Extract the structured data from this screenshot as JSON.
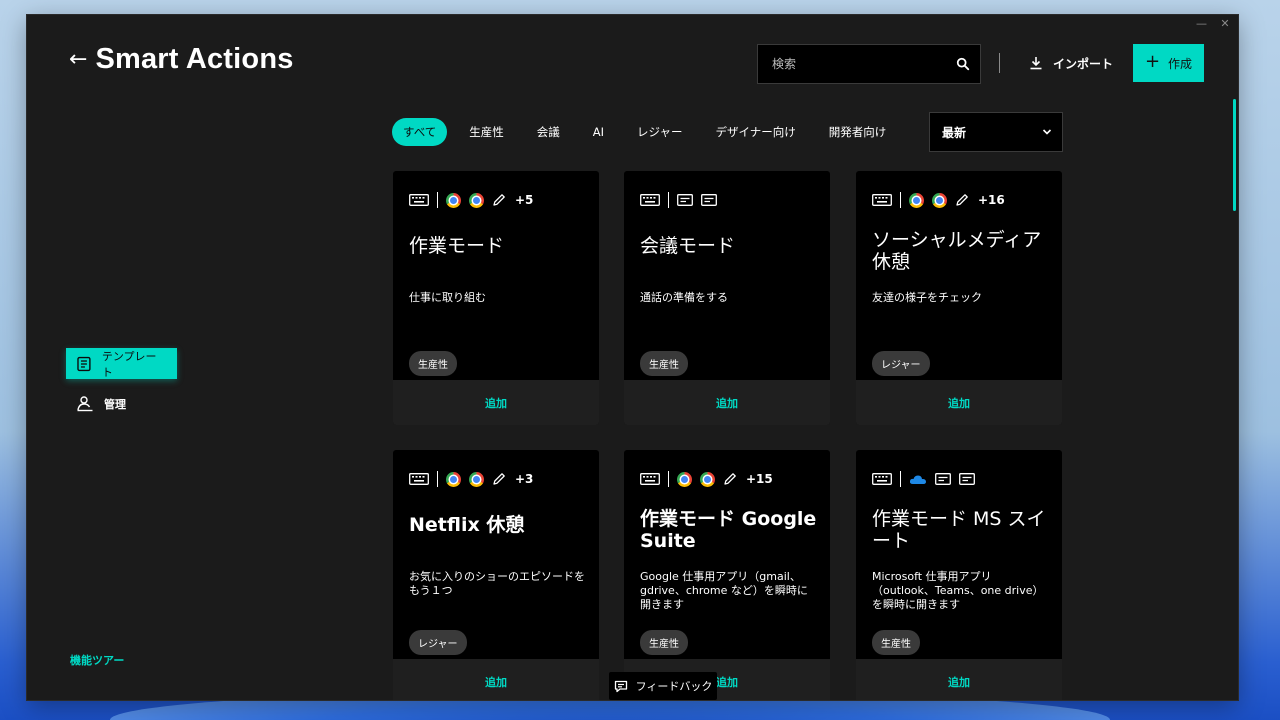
{
  "window": {
    "title": "Smart Actions"
  },
  "header": {
    "title": "Smart Actions",
    "search_placeholder": "検索",
    "import_label": "インポート",
    "create_label": "作成"
  },
  "filters": {
    "chips": [
      "すべて",
      "生産性",
      "会議",
      "AI",
      "レジャー",
      "デザイナー向け",
      "開発者向け"
    ],
    "active_index": 0,
    "sort_value": "最新"
  },
  "sidebar": {
    "items": [
      {
        "label": "テンプレート",
        "icon": "template-icon",
        "active": true
      },
      {
        "label": "管理",
        "icon": "manage-icon",
        "active": false
      }
    ],
    "feature_tour": "機能ツアー"
  },
  "cards": [
    {
      "icons": [
        "keyboard-icon",
        "chrome-icon",
        "chrome-icon",
        "pencil-icon"
      ],
      "more": "+5",
      "title": "作業モード",
      "description": "仕事に取り組む",
      "tag": "生産性",
      "add_label": "追加"
    },
    {
      "icons": [
        "keyboard-icon",
        "window-icon",
        "window-icon"
      ],
      "more": "",
      "title": "会議モード",
      "description": "通話の準備をする",
      "tag": "生産性",
      "add_label": "追加"
    },
    {
      "icons": [
        "keyboard-icon",
        "chrome-icon",
        "chrome-icon",
        "pencil-icon"
      ],
      "more": "+16",
      "title": "ソーシャルメディア休憩",
      "description": "友達の様子をチェック",
      "tag": "レジャー",
      "add_label": "追加"
    },
    {
      "icons": [
        "keyboard-icon",
        "chrome-icon",
        "chrome-icon",
        "pencil-icon"
      ],
      "more": "+3",
      "title": "Netflix 休憩",
      "description": "お気に入りのショーのエピソードをもう１つ",
      "tag": "レジャー",
      "add_label": "追加"
    },
    {
      "icons": [
        "keyboard-icon",
        "chrome-icon",
        "chrome-icon",
        "pencil-icon"
      ],
      "more": "+15",
      "title": "作業モード Google Suite",
      "description": "Google 仕事用アプリ（gmail、gdrive、chrome など）を瞬時に開きます",
      "tag": "生産性",
      "add_label": "追加"
    },
    {
      "icons": [
        "keyboard-icon",
        "onedrive-icon",
        "window-icon",
        "window-icon"
      ],
      "more": "",
      "title": "作業モード MS スイート",
      "description": "Microsoft 仕事用アプリ（outlook、Teams、one drive）を瞬時に開きます",
      "tag": "生産性",
      "add_label": "追加"
    }
  ],
  "feedback": {
    "label": "フィードバック"
  },
  "colors": {
    "accent": "#00d9c4",
    "background": "#1b1b1b",
    "card": "#000000"
  }
}
